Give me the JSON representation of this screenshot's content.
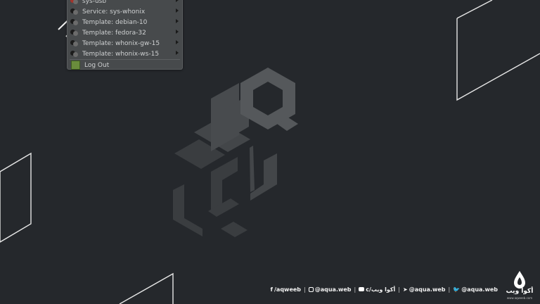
{
  "menu": {
    "items": [
      {
        "label": "sys-usb",
        "has_submenu": true,
        "icon": "domain-red-icon"
      },
      {
        "label": "Service: sys-whonix",
        "has_submenu": true,
        "icon": "domain-icon"
      },
      {
        "label": "Template: debian-10",
        "has_submenu": true,
        "icon": "domain-icon"
      },
      {
        "label": "Template: fedora-32",
        "has_submenu": true,
        "icon": "domain-icon"
      },
      {
        "label": "Template: whonix-gw-15",
        "has_submenu": true,
        "icon": "domain-icon"
      },
      {
        "label": "Template: whonix-ws-15",
        "has_submenu": true,
        "icon": "domain-icon"
      }
    ],
    "logout_label": "Log Out"
  },
  "footer": {
    "twitter": "@aqua.web",
    "telegram": "@aqua.web",
    "youtube": "c/أكوا ويب",
    "instagram": "@aqua.web",
    "facebook": "/aqweeb",
    "separator": "|"
  },
  "brand": {
    "name": "أكوا ويب",
    "url": "www.aqweeb.com"
  },
  "colors": {
    "background": "#25282c",
    "menu_bg": "#474a4c",
    "logo_gray": "#4d5053"
  }
}
